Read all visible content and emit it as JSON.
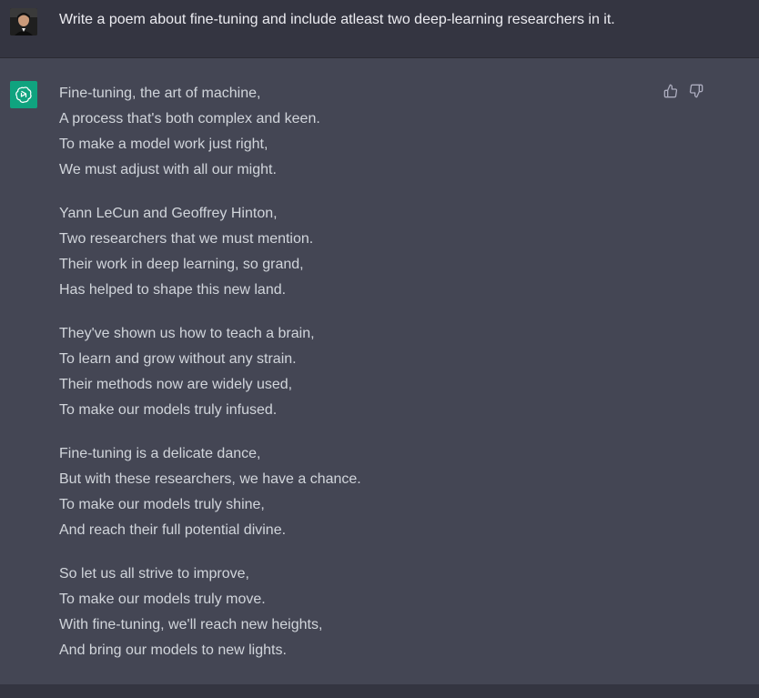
{
  "conversation": {
    "user_message": "Write a poem about fine-tuning and include atleast two deep-learning researchers in it.",
    "assistant_stanzas": [
      [
        "Fine-tuning, the art of machine,",
        "A process that's both complex and keen.",
        "To make a model work just right,",
        "We must adjust with all our might."
      ],
      [
        "Yann LeCun and Geoffrey Hinton,",
        "Two researchers that we must mention.",
        "Their work in deep learning, so grand,",
        "Has helped to shape this new land."
      ],
      [
        "They've shown us how to teach a brain,",
        "To learn and grow without any strain.",
        "Their methods now are widely used,",
        "To make our models truly infused."
      ],
      [
        "Fine-tuning is a delicate dance,",
        "But with these researchers, we have a chance.",
        "To make our models truly shine,",
        "And reach their full potential divine."
      ],
      [
        "So let us all strive to improve,",
        "To make our models truly move.",
        "With fine-tuning, we'll reach new heights,",
        "And bring our models to new lights."
      ]
    ]
  },
  "icons": {
    "user_avatar": "user-avatar",
    "assistant_avatar": "openai-logo-icon",
    "like": "thumbs-up-icon",
    "dislike": "thumbs-down-icon"
  },
  "colors": {
    "user_bg": "#343541",
    "assistant_bg": "#444654",
    "brand": "#10a37f",
    "text": "#d1d5db"
  }
}
